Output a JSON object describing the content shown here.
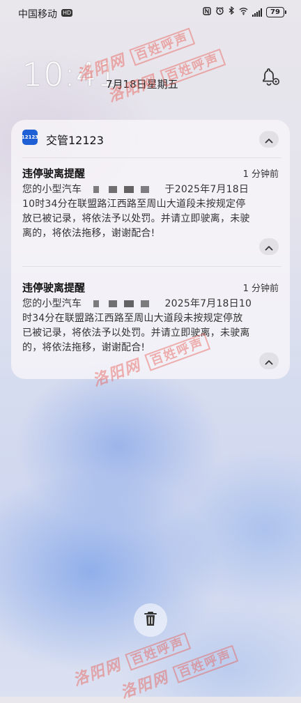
{
  "status_bar": {
    "carrier": "中国移动",
    "network_badge": "HD",
    "icons": [
      "nfc-icon",
      "alarm-icon",
      "bluetooth-icon",
      "wifi-signal-icon",
      "cell-signal-icon"
    ],
    "battery": "79"
  },
  "lockscreen": {
    "time": "10:41",
    "date": "7月18日星期五"
  },
  "notification_group": {
    "app_icon_text": "12123",
    "app_name": "交管12123",
    "notifications": [
      {
        "title": "违停驶离提醒",
        "time": "1 分钟前",
        "body_prefix": "您的小型汽车",
        "body_suffix": "于2025年7月18日10时34分在联盟路江西路至周山大道段未按规定停放已被记录，将依法予以处罚。并请立即驶离，未驶离的，将依法拖移，谢谢配合!"
      },
      {
        "title": "违停驶离提醒",
        "time": "1 分钟前",
        "body_prefix": "您的小型汽车",
        "body_suffix": "2025年7月18日10时34分在联盟路江西路至周山大道段未按规定停放已被记录，将依法予以处罚。并请立即驶离，未驶离的，将依法拖移，谢谢配合!"
      }
    ]
  },
  "watermarks": {
    "site": "洛阳网",
    "brand": "百姓呼声"
  },
  "colors": {
    "app_icon": "#1f5fd6",
    "watermark": "#e85c52"
  }
}
